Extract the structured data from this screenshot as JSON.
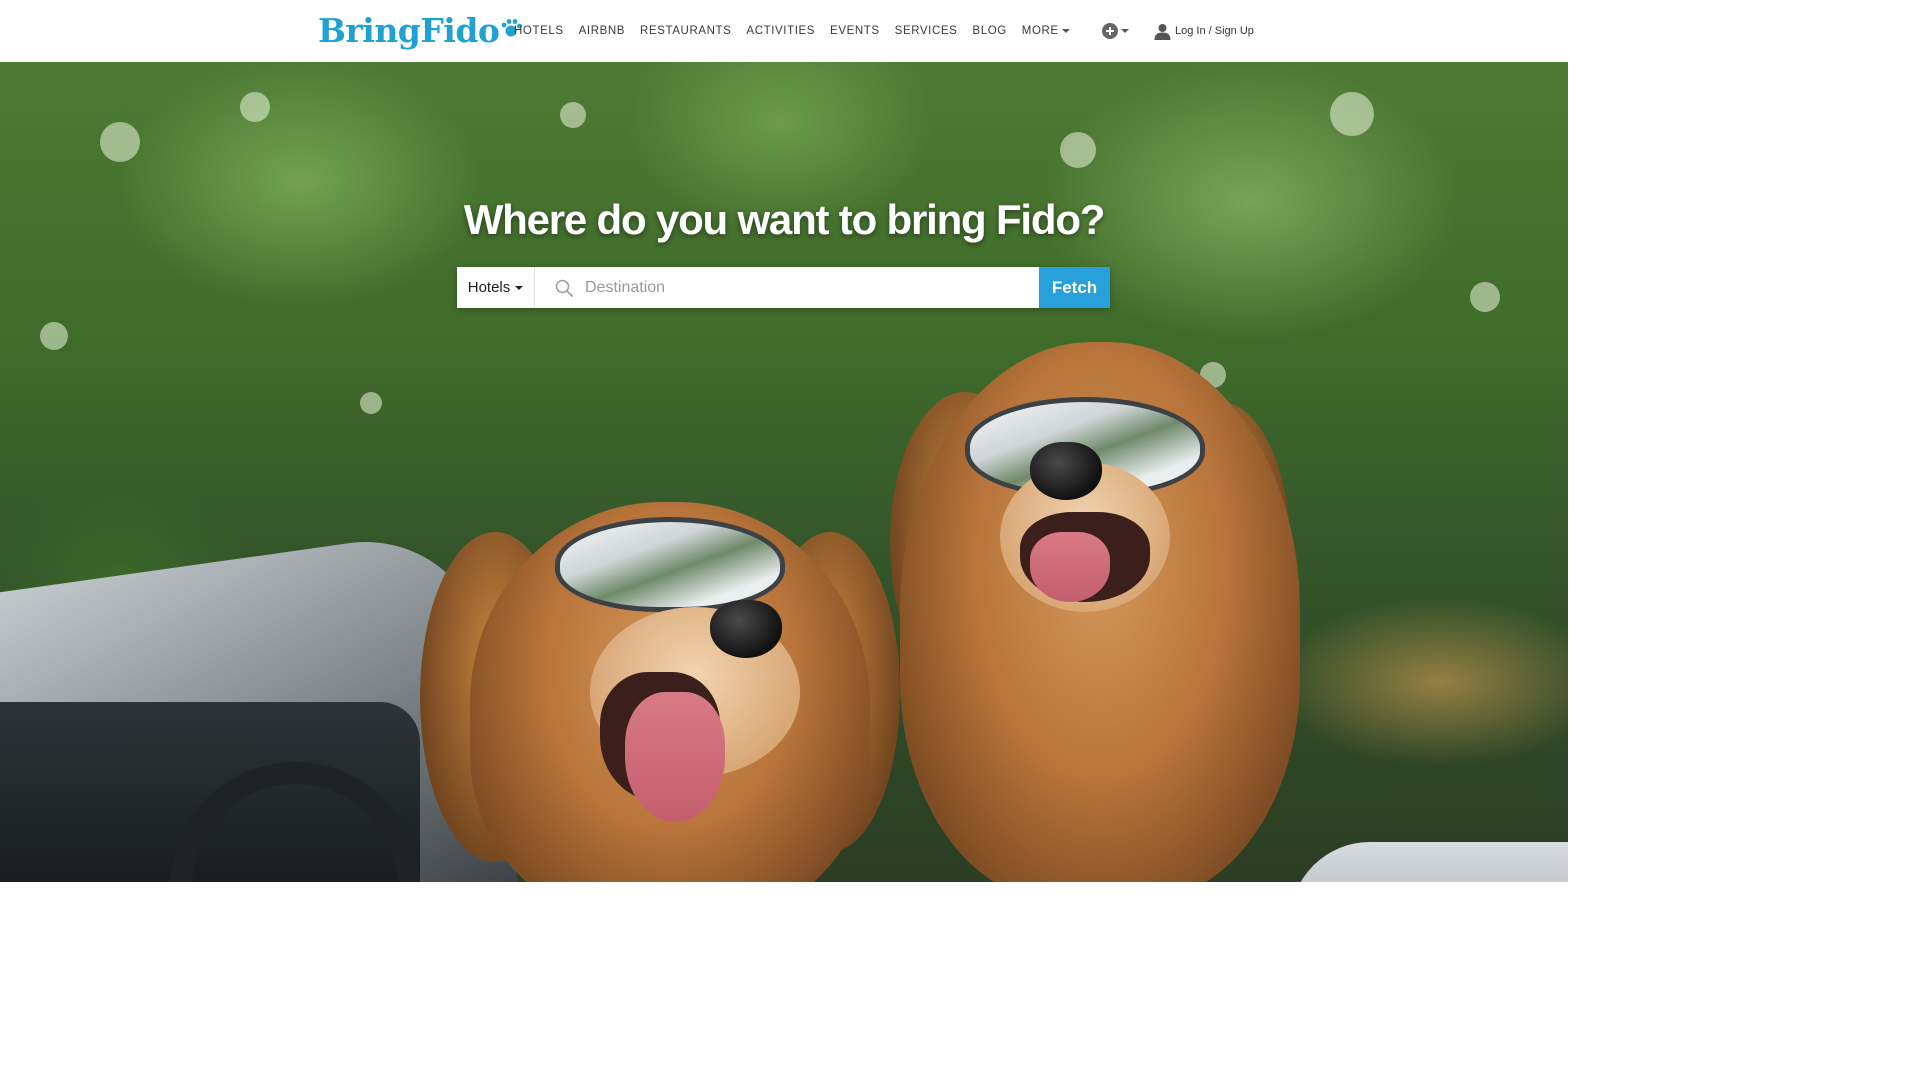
{
  "brand": {
    "logo_text": "BringFido",
    "accent": "#1fa1d6"
  },
  "nav": {
    "items": [
      {
        "label": "HOTELS"
      },
      {
        "label": "AIRBNB"
      },
      {
        "label": "RESTAURANTS"
      },
      {
        "label": "ACTIVITIES"
      },
      {
        "label": "EVENTS"
      },
      {
        "label": "SERVICES"
      },
      {
        "label": "BLOG"
      },
      {
        "label": "MORE"
      }
    ],
    "add_icon": "plus-circle-icon",
    "login_label": "Log In / Sign Up",
    "login_icon": "user-icon"
  },
  "hero": {
    "title": "Where do you want to bring Fido?",
    "search": {
      "type_selected": "Hotels",
      "placeholder": "Destination",
      "value": "",
      "button_label": "Fetch",
      "button_color": "#27a0dc"
    }
  }
}
